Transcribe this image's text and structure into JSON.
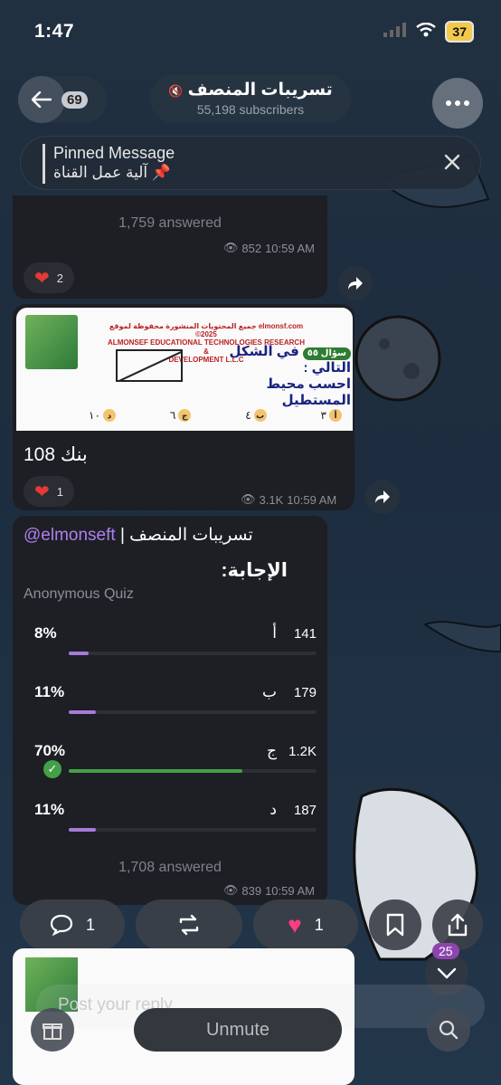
{
  "status_bar": {
    "time": "1:47",
    "battery": "37"
  },
  "header": {
    "back_count": "69",
    "channel_name": "تسريبات المنصف",
    "subscribers": "55,198 subscribers"
  },
  "pinned": {
    "label": "Pinned Message",
    "text": "آلية عمل القناة"
  },
  "message1": {
    "answered": "1,759 answered",
    "views": "852",
    "time": "10:59 AM",
    "reaction_count": "2"
  },
  "message2": {
    "image": {
      "header_line1": "جميع المحتويات المنشورة محفوظة لموقع elmonsf.com ©2025",
      "header_line2": "ALMONSEF EDUCATIONAL TECHNOLOGIES RESEARCH &",
      "header_line3": "DEVELOPMENT L.L.C",
      "question_tag": "سؤال ٥٥",
      "question_line1": "في الشكل التالي :",
      "question_line2": "احسب محيط المستطيل",
      "options": [
        {
          "letter": "أ",
          "value": "٣"
        },
        {
          "letter": "ب",
          "value": "٤"
        },
        {
          "letter": "ج",
          "value": "٦"
        },
        {
          "letter": "د",
          "value": "١٠"
        }
      ]
    },
    "caption": "بنك 108",
    "views": "3.1K",
    "time": "10:59 AM",
    "reaction_count": "1"
  },
  "poll": {
    "sender_name": "تسريبات المنصف",
    "sender_handle": "@elmonseft",
    "question": "الإجابة:",
    "kind": "Anonymous Quiz",
    "options": [
      {
        "letter": "أ",
        "votes": "141",
        "percent_label": "8%",
        "percent": 8,
        "correct": false
      },
      {
        "letter": "ب",
        "votes": "179",
        "percent_label": "11%",
        "percent": 11,
        "correct": false
      },
      {
        "letter": "ج",
        "votes": "1.2K",
        "percent_label": "70%",
        "percent": 70,
        "correct": true
      },
      {
        "letter": "د",
        "votes": "187",
        "percent_label": "11%",
        "percent": 11,
        "correct": false
      }
    ],
    "answered": "1,708 answered",
    "views": "839",
    "time": "10:59 AM"
  },
  "action_bar": {
    "comments": "1",
    "likes": "1",
    "unread_badge": "25"
  },
  "composer": {
    "placeholder": "Post your reply",
    "unmute_label": "Unmute"
  },
  "colors": {
    "accent_purple": "#a77bd9",
    "correct_green": "#43a047",
    "heart_red": "#e53935",
    "like_pink": "#ff3d7f"
  }
}
